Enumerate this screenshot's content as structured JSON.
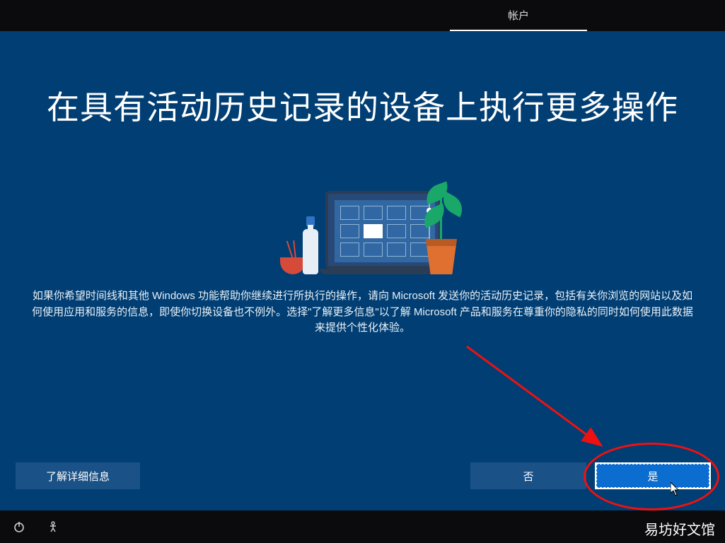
{
  "topbar": {
    "tab_label": "帐户"
  },
  "title": "在具有活动历史记录的设备上执行更多操作",
  "body": "如果你希望时间线和其他 Windows 功能帮助你继续进行所执行的操作，请向 Microsoft 发送你的活动历史记录，包括有关你浏览的网站以及如何使用应用和服务的信息，即使你切换设备也不例外。选择\"了解更多信息\"以了解 Microsoft 产品和服务在尊重你的隐私的同时如何使用此数据来提供个性化体验。",
  "buttons": {
    "learn_more": "了解详细信息",
    "no": "否",
    "yes": "是"
  },
  "watermark": "易坊好文馆",
  "icons": {
    "power": "power-icon",
    "accessibility": "accessibility-icon"
  }
}
